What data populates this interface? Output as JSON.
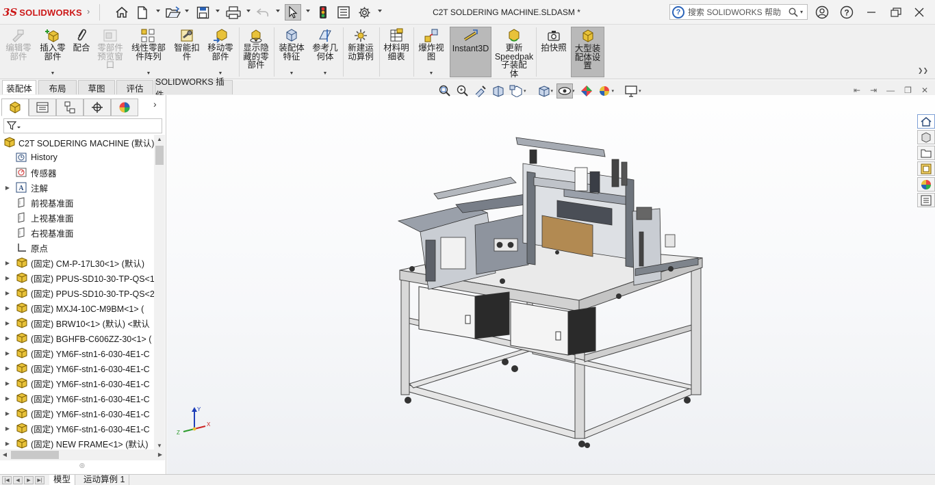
{
  "app": {
    "logo_ds": "3S",
    "logo_text": "SOLIDWORKS",
    "doc_title": "C2T SOLDERING MACHINE.SLDASM *"
  },
  "search": {
    "placeholder": "搜索 SOLIDWORKS 帮助"
  },
  "quick_access": [
    "home-icon",
    "new-document-icon",
    "open-icon",
    "save-icon",
    "print-icon",
    "undo-icon",
    "select-arrow-icon",
    "traffic-light-icon",
    "file-properties-icon",
    "options-gear-icon"
  ],
  "window_controls": [
    "user-icon",
    "help-icon",
    "minimize-icon",
    "maximize-icon",
    "close-icon"
  ],
  "ribbon": {
    "buttons": [
      {
        "label": "编辑零\n部件",
        "enabled": false
      },
      {
        "label": "插入零\n部件",
        "enabled": true
      },
      {
        "label": "配合",
        "enabled": true
      },
      {
        "label": "零部件\n预览窗\n口",
        "enabled": false
      },
      {
        "label": "线性零部\n件阵列",
        "enabled": true
      },
      {
        "label": "智能扣\n件",
        "enabled": true
      },
      {
        "label": "移动零\n部件",
        "enabled": true
      },
      {
        "label": "显示隐\n藏的零\n部件",
        "enabled": true
      },
      {
        "label": "装配体\n特征",
        "enabled": true
      },
      {
        "label": "参考几\n何体",
        "enabled": true
      },
      {
        "label": "新建运\n动算例",
        "enabled": true
      },
      {
        "label": "材料明\n细表",
        "enabled": true
      },
      {
        "label": "爆炸视\n图",
        "enabled": true
      },
      {
        "label": "Instant3D",
        "enabled": true,
        "active": true
      },
      {
        "label": "更新\nSpeedpak\n子装配\n体",
        "enabled": true
      },
      {
        "label": "拍快照",
        "enabled": true
      },
      {
        "label": "大型装\n配体设\n置",
        "enabled": true,
        "active": true
      }
    ]
  },
  "tabs": [
    {
      "label": "装配体",
      "active": true
    },
    {
      "label": "布局"
    },
    {
      "label": "草图"
    },
    {
      "label": "评估"
    },
    {
      "label": "SOLIDWORKS 插件"
    }
  ],
  "tree": {
    "root": "C2T SOLDERING MACHINE  (默认)",
    "items": [
      {
        "label": "History",
        "icon": "history-icon",
        "expandable": false
      },
      {
        "label": "传感器",
        "icon": "sensor-icon",
        "expandable": false
      },
      {
        "label": "注解",
        "icon": "annotation-icon",
        "expandable": true
      },
      {
        "label": "前视基准面",
        "icon": "plane-icon",
        "expandable": false
      },
      {
        "label": "上视基准面",
        "icon": "plane-icon",
        "expandable": false
      },
      {
        "label": "右视基准面",
        "icon": "plane-icon",
        "expandable": false
      },
      {
        "label": "原点",
        "icon": "origin-icon",
        "expandable": false
      },
      {
        "label": "(固定) CM-P-17L30<1> (默认)",
        "icon": "part-icon",
        "expandable": true
      },
      {
        "label": "(固定) PPUS-SD10-30-TP-QS<1",
        "icon": "part-icon",
        "expandable": true
      },
      {
        "label": "(固定) PPUS-SD10-30-TP-QS<2",
        "icon": "part-icon",
        "expandable": true
      },
      {
        "label": "(固定) MXJ4-10C-M9BM<1> (",
        "icon": "part-icon",
        "expandable": true
      },
      {
        "label": "(固定) BRW10<1> (默认) <默认",
        "icon": "part-icon",
        "expandable": true
      },
      {
        "label": "(固定) BGHFB-C606ZZ-30<1> (",
        "icon": "part-icon",
        "expandable": true
      },
      {
        "label": "(固定) YM6F-stn1-6-030-4E1-C",
        "icon": "part-icon",
        "expandable": true
      },
      {
        "label": "(固定) YM6F-stn1-6-030-4E1-C",
        "icon": "part-icon",
        "expandable": true
      },
      {
        "label": "(固定) YM6F-stn1-6-030-4E1-C",
        "icon": "part-icon",
        "expandable": true
      },
      {
        "label": "(固定) YM6F-stn1-6-030-4E1-C",
        "icon": "part-icon",
        "expandable": true
      },
      {
        "label": "(固定) YM6F-stn1-6-030-4E1-C",
        "icon": "part-icon",
        "expandable": true
      },
      {
        "label": "(固定) YM6F-stn1-6-030-4E1-C",
        "icon": "part-icon",
        "expandable": true
      },
      {
        "label": "(固定) NEW FRAME<1> (默认)",
        "icon": "part-icon",
        "expandable": true
      }
    ]
  },
  "triad": {
    "x": "X",
    "y": "Y",
    "z": "Z"
  },
  "bottom_tabs": [
    {
      "label": "模型",
      "active": true
    },
    {
      "label": "运动算例 1"
    }
  ],
  "colors": {
    "brand_red": "#cc1818",
    "accent_blue": "#2a63b8",
    "part_yellow": "#e8c23a"
  }
}
